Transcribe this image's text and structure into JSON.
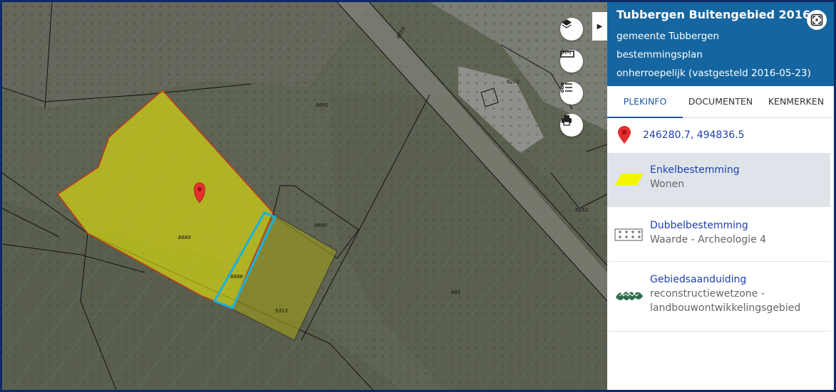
{
  "plan": {
    "title": "Tubbergen Buitengebied 2016",
    "municipality": "gemeente Tubbergen",
    "type": "bestemmingsplan",
    "status": "onherroepelijk (vastgesteld 2016-05-23)"
  },
  "tabs": [
    {
      "label": "PLEKINFO"
    },
    {
      "label": "DOCUMENTEN"
    },
    {
      "label": "KENMERKEN"
    }
  ],
  "location": {
    "coordinates": "246280.7, 494836.5"
  },
  "items": [
    {
      "title": "Enkelbestemming",
      "sub": "Wonen"
    },
    {
      "title": "Dubbelbestemming",
      "sub": "Waarde - Archeologie 4"
    },
    {
      "title": "Gebiedsaanduiding",
      "sub1": "reconstructiewetzone -",
      "sub2": "landbouwontwikkelingsgebied"
    }
  ],
  "map": {
    "parcel_labels": [
      "8510",
      "6292",
      "8691",
      "8690",
      "8689",
      "8688",
      "5313",
      "885",
      "8182"
    ],
    "controls": [
      "layers-icon",
      "measure-icon",
      "legend-icon",
      "print-icon"
    ]
  },
  "colors": {
    "header": "#1566a0",
    "accent": "#1f3fb0",
    "enkel": "#f5f500",
    "selection": "#1ab0e0",
    "outline": "#c0391b"
  }
}
